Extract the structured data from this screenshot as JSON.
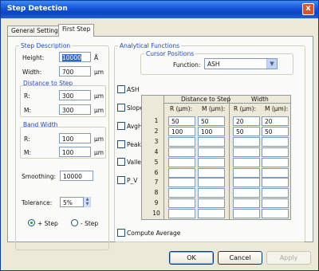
{
  "window": {
    "title": "Step Detection",
    "close_label": "x"
  },
  "tabs": [
    {
      "label": "General Settings",
      "active": false
    },
    {
      "label": "First Step",
      "active": true
    }
  ],
  "step_description": {
    "legend": "Step Description",
    "height_label": "Height:",
    "height_value": "10000",
    "height_unit": "Å",
    "width_label": "Width:",
    "width_value": "700",
    "width_unit": "µm"
  },
  "distance_to_step": {
    "header": "Distance to Step",
    "r_label": "R:",
    "r_value": "300",
    "r_unit": "µm",
    "m_label": "M:",
    "m_value": "300",
    "m_unit": "µm"
  },
  "band_width": {
    "header": "Band Width",
    "r_label": "R:",
    "r_value": "100",
    "r_unit": "µm",
    "m_label": "M:",
    "m_value": "100",
    "m_unit": "µm"
  },
  "smoothing": {
    "label": "Smoothing:",
    "value": "10000"
  },
  "tolerance": {
    "label": "Tolerance:",
    "value": "5%"
  },
  "step_direction": {
    "plus_label": "+ Step",
    "minus_label": "- Step",
    "selected": "+ Step"
  },
  "analytical": {
    "legend": "Analytical Functions",
    "cursor_positions_label": "Cursor Positions",
    "function_label": "Function:",
    "function_value": "ASH",
    "checkboxes": [
      "ASH",
      "Slope",
      "AvgHt",
      "Peak",
      "Valley",
      "P_V"
    ]
  },
  "grid": {
    "group_distance": "Distance to Step",
    "group_width": "Width",
    "col_r": "R (µm):",
    "col_m": "M (µm):",
    "col_r2": "R (µm):",
    "col_m2": "M (µm):",
    "rows": [
      {
        "n": "1",
        "d_r": "50",
        "d_m": "50",
        "w_r": "20",
        "w_m": "20"
      },
      {
        "n": "2",
        "d_r": "100",
        "d_m": "100",
        "w_r": "50",
        "w_m": "50"
      },
      {
        "n": "3",
        "d_r": "",
        "d_m": "",
        "w_r": "",
        "w_m": ""
      },
      {
        "n": "4",
        "d_r": "",
        "d_m": "",
        "w_r": "",
        "w_m": ""
      },
      {
        "n": "5",
        "d_r": "",
        "d_m": "",
        "w_r": "",
        "w_m": ""
      },
      {
        "n": "6",
        "d_r": "",
        "d_m": "",
        "w_r": "",
        "w_m": ""
      },
      {
        "n": "7",
        "d_r": "",
        "d_m": "",
        "w_r": "",
        "w_m": ""
      },
      {
        "n": "8",
        "d_r": "",
        "d_m": "",
        "w_r": "",
        "w_m": ""
      },
      {
        "n": "9",
        "d_r": "",
        "d_m": "",
        "w_r": "",
        "w_m": ""
      },
      {
        "n": "10",
        "d_r": "",
        "d_m": "",
        "w_r": "",
        "w_m": ""
      }
    ]
  },
  "compute_average_label": "Compute Average",
  "buttons": {
    "ok": "OK",
    "cancel": "Cancel",
    "apply": "Apply"
  }
}
